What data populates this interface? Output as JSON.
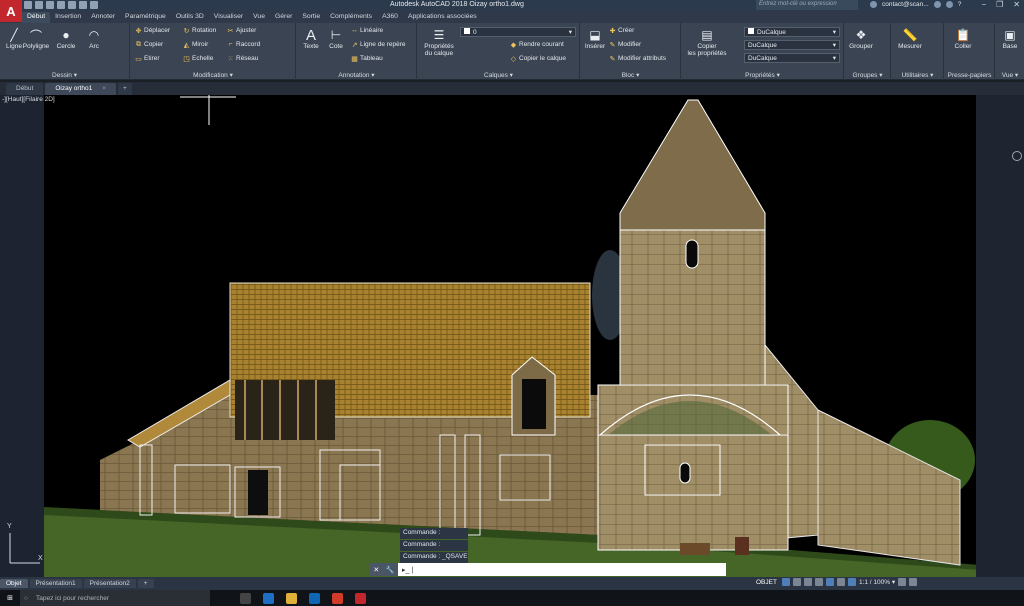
{
  "app": {
    "logo": "A",
    "title": "Autodesk AutoCAD 2018    Oizay ortho1.dwg",
    "search_placeholder": "Entrez mot-clé ou expression",
    "user": "contact@scan...",
    "help": "?"
  },
  "ribbon_tabs": [
    "Début",
    "Insertion",
    "Annoter",
    "Paramétrique",
    "Outils 3D",
    "Visualiser",
    "Vue",
    "Gérer",
    "Sortie",
    "Compléments",
    "A360",
    "Applications associées"
  ],
  "ribbon": {
    "dessin": {
      "title": "Dessin ▾",
      "tools": [
        "Ligne",
        "Polyligne",
        "Cercle",
        "Arc"
      ]
    },
    "modification": {
      "title": "Modification ▾",
      "tools": [
        "Déplacer",
        "Rotation",
        "Ajuster",
        "Copier",
        "Miroir",
        "Raccord",
        "Etirer",
        "Echelle",
        "Réseau"
      ]
    },
    "annotation": {
      "title": "Annotation ▾",
      "big": [
        "Texte",
        "Cote"
      ],
      "tools": [
        "Linéaire",
        "Ligne de repère",
        "Tableau"
      ]
    },
    "calques": {
      "title": "Calques ▾",
      "big": "Propriétés\ndu calque",
      "layer_value": "0",
      "tools": [
        "Rendre courant",
        "Copier le calque"
      ]
    },
    "bloc": {
      "title": "Bloc ▾",
      "big": "Insérer",
      "tools": [
        "Créer",
        "Modifier",
        "Modifier attributs"
      ]
    },
    "proprietes": {
      "title": "Propriétés ▾",
      "big": "Copier\nles propriétés",
      "combos": [
        "DuCalque",
        "DuCalque",
        "DuCalque"
      ]
    },
    "groupes": {
      "title": "Groupes ▾",
      "big": "Grouper"
    },
    "utilitaires": {
      "title": "Utilitaires ▾",
      "big": "Mesurer"
    },
    "presse_papiers": {
      "title": "Presse-papiers",
      "big": "Coller"
    },
    "vue": {
      "title": "Vue ▾",
      "big": "Base"
    }
  },
  "document_tabs": [
    {
      "label": "Début",
      "active": false
    },
    {
      "label": "Oizay ortho1",
      "active": true,
      "close": "×"
    },
    {
      "label": "+"
    }
  ],
  "viewport": {
    "label": "-][Haut][Filaire 2D]",
    "ucs_y": "Y",
    "ucs_x": "X"
  },
  "command": {
    "history": [
      "Commande :",
      "Commande :",
      "Commande :  _QSAVE"
    ],
    "prompt": "▸_ |"
  },
  "layout_tabs": [
    {
      "label": "Objet",
      "active": true
    },
    {
      "label": "Présentation1",
      "active": false
    },
    {
      "label": "Présentation2",
      "active": false
    },
    {
      "label": "+",
      "active": false
    }
  ],
  "status": {
    "mode": "OBJET",
    "scale": "1:1 / 100% ▾"
  },
  "taskbar": {
    "search_placeholder": "Tapez ici pour rechercher"
  },
  "colors": {
    "autocad_red": "#c2272d",
    "ribbon_bg": "#3b4453",
    "viewport_bg": "#000000",
    "stone": "#8e7a55",
    "roof_tiles": "#a8822e"
  }
}
